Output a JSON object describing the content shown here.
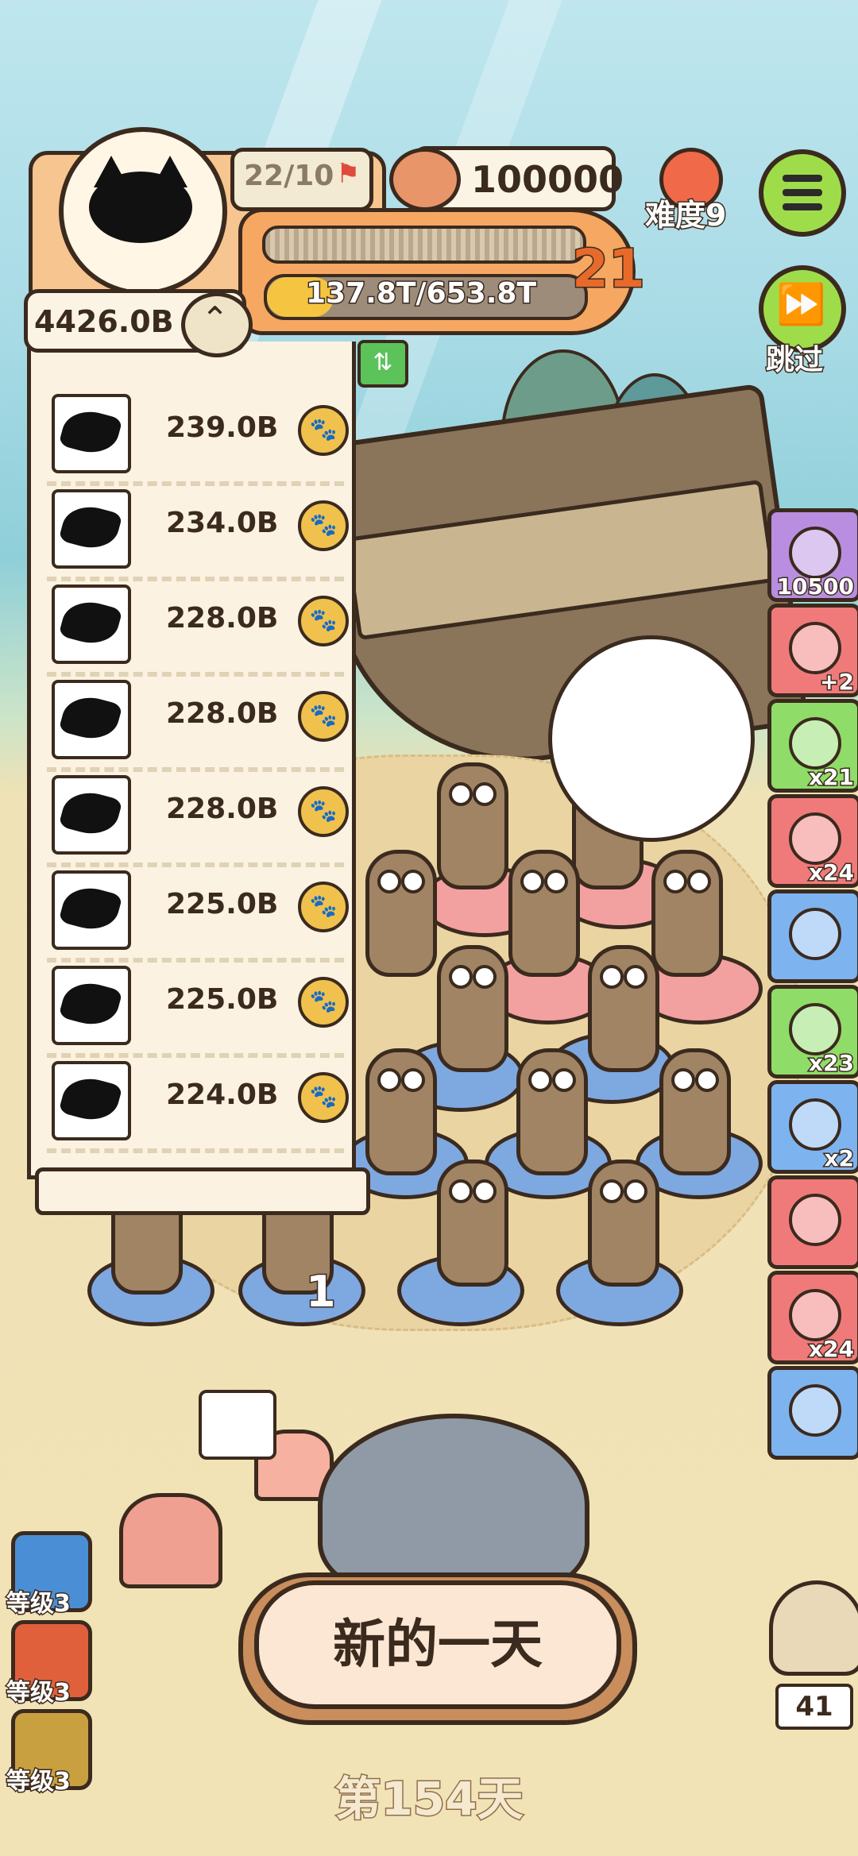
{
  "hud": {
    "level_progress": "22/10",
    "coins": "100000",
    "difficulty": "难度9",
    "player_level": "21",
    "progress_text": "137.8T/653.8T",
    "progress_fraction": 0.21,
    "skip_label": "跳过"
  },
  "money": {
    "total": "4426.0B",
    "rows": [
      {
        "value": "239.0B"
      },
      {
        "value": "234.0B"
      },
      {
        "value": "228.0B"
      },
      {
        "value": "228.0B"
      },
      {
        "value": "228.0B"
      },
      {
        "value": "225.0B"
      },
      {
        "value": "225.0B"
      },
      {
        "value": "224.0B"
      }
    ]
  },
  "items": [
    {
      "icon": "rock-bag-icon",
      "count": "10500",
      "color": "#b98ee0"
    },
    {
      "icon": "rock-plus-icon",
      "count": "+2",
      "color": "#f07a7a"
    },
    {
      "icon": "helmet-icon",
      "count": "x21",
      "color": "#8fdc68"
    },
    {
      "icon": "snorkel-icon",
      "count": "x24",
      "color": "#f07a7a"
    },
    {
      "icon": "camera-icon",
      "count": "",
      "color": "#7db4f0"
    },
    {
      "icon": "lollipop-icon",
      "count": "x23",
      "color": "#8fdc68"
    },
    {
      "icon": "donut-icon",
      "count": "x2",
      "color": "#7db4f0"
    },
    {
      "icon": "green-ball-icon",
      "count": "",
      "color": "#f07a7a"
    },
    {
      "icon": "bomb-icon",
      "count": "x24",
      "color": "#f07a7a"
    },
    {
      "icon": "feather-icon",
      "count": "",
      "color": "#7db4f0"
    }
  ],
  "levels": [
    {
      "label": "等级3",
      "color": "#4a8fd6"
    },
    {
      "label": "等级3",
      "color": "#e0603c"
    },
    {
      "label": "等级3",
      "color": "#c9a040"
    }
  ],
  "bottom": {
    "new_day": "新的一天",
    "day": "第154天",
    "owl_count": "41",
    "slot_number": "1"
  }
}
